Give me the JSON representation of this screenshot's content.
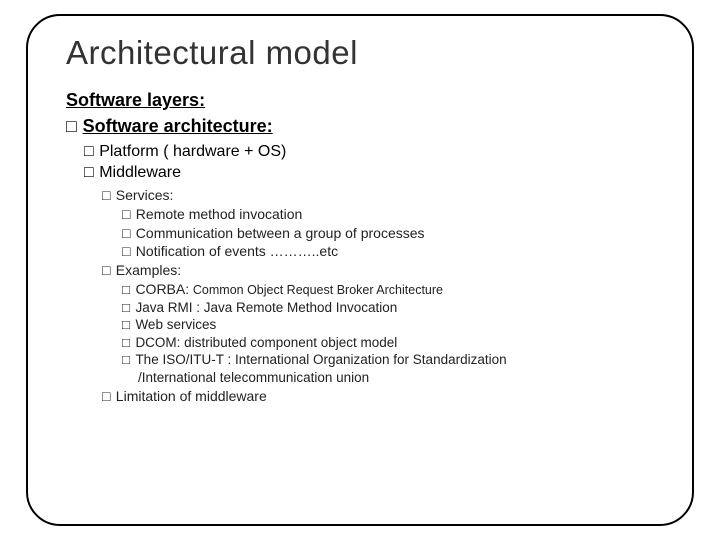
{
  "title": "Architectural model",
  "lvl1_heading": "Software layers:",
  "lvl1b_item": "Software architecture:",
  "lvl2": {
    "platform": "Platform ( hardware + OS)",
    "middleware": "Middleware"
  },
  "lvl3": {
    "services": "Services:",
    "examples": "Examples:",
    "limitation": "Limitation of middleware"
  },
  "services_items": {
    "a": "Remote method invocation",
    "b": "Communication between a group of processes",
    "c": "Notification of events ………..etc"
  },
  "examples_items": {
    "corba_label": "CORBA:",
    "corba_desc": "Common Object Request Broker Architecture",
    "java": "Java RMI : Java Remote Method Invocation",
    "web": "Web services",
    "dcom": "DCOM: distributed component object model",
    "iso1": "The ISO/ITU-T : International Organization for Standardization",
    "iso2": "/International telecommunication union"
  },
  "bullet": "□"
}
